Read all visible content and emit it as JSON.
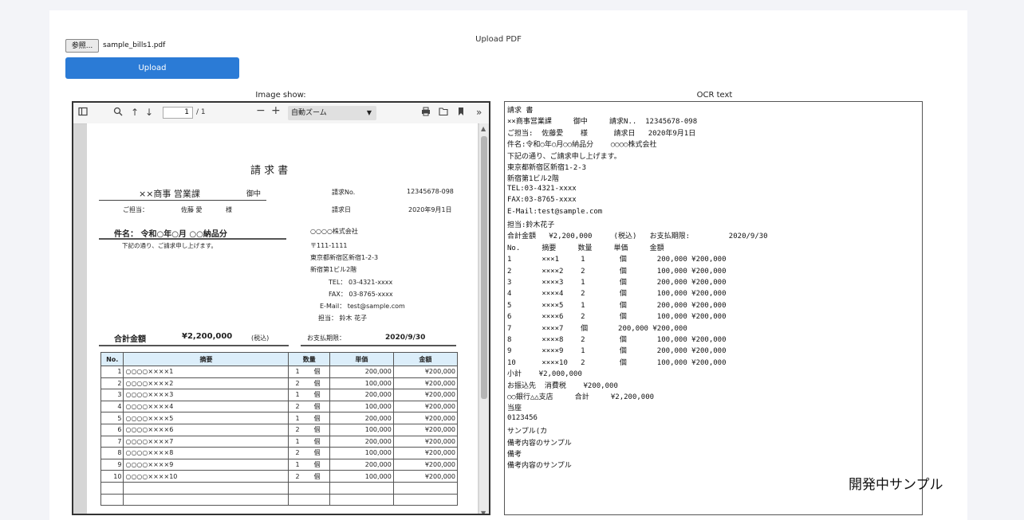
{
  "app": {
    "title": "Upload PDF",
    "browse_label": "参照...",
    "file_name": "sample_bills1.pdf",
    "upload_label": "Upload",
    "image_label": "Image show:",
    "ocr_label": "OCR text",
    "watermark": "開発中サンプル"
  },
  "viewer": {
    "page_value": "1",
    "page_total": "/ 1",
    "zoom_label": "自動ズーム"
  },
  "doc": {
    "title": "請 求 書",
    "recipient": "××商事 営業課",
    "onchu": "御中",
    "tantou_label": "ご担当：",
    "tantou_name": "佐藤 愛",
    "sama": "様",
    "inv_no_label": "請求No.",
    "inv_no": "12345678-098",
    "date_label": "請求日",
    "date": "2020年9月1日",
    "subject": "件名： 令和○年○月 ○○納品分",
    "note": "下記の通り、ご請求申し上げます。",
    "company": "○○○○株式会社",
    "zip": "〒111-1111",
    "addr1": "東京都新宿区新宿1-2-3",
    "addr2": "新宿第1ビル2階",
    "tel": "TEL： 03-4321-xxxx",
    "fax": "FAX： 03-8765-xxxx",
    "email": "E-Mail： test@sample.com",
    "staff": "担当： 鈴木 花子",
    "total_label": "合計金額",
    "total": "¥2,200,000",
    "tax_note": "(税込)",
    "due_label": "お支払期限：",
    "due": "2020/9/30",
    "headers": [
      "No.",
      "摘要",
      "数量",
      "単価",
      "金額"
    ],
    "rows": [
      [
        "1",
        "○○○○××××1",
        "1",
        "個",
        "200,000",
        "¥200,000"
      ],
      [
        "2",
        "○○○○××××2",
        "2",
        "個",
        "100,000",
        "¥200,000"
      ],
      [
        "3",
        "○○○○××××3",
        "1",
        "個",
        "200,000",
        "¥200,000"
      ],
      [
        "4",
        "○○○○××××4",
        "2",
        "個",
        "100,000",
        "¥200,000"
      ],
      [
        "5",
        "○○○○××××5",
        "1",
        "個",
        "200,000",
        "¥200,000"
      ],
      [
        "6",
        "○○○○××××6",
        "2",
        "個",
        "100,000",
        "¥200,000"
      ],
      [
        "7",
        "○○○○××××7",
        "1",
        "個",
        "200,000",
        "¥200,000"
      ],
      [
        "8",
        "○○○○××××8",
        "2",
        "個",
        "100,000",
        "¥200,000"
      ],
      [
        "9",
        "○○○○××××9",
        "1",
        "個",
        "200,000",
        "¥200,000"
      ],
      [
        "10",
        "○○○○××××10",
        "2",
        "個",
        "100,000",
        "¥200,000"
      ]
    ]
  },
  "ocr_lines": [
    "請求 書",
    "××商事営業課     御中     請求N..  12345678-098",
    "ご担当:  佐藤愛    様      請求日   2020年9月1日",
    "件名:令和○年○月○○納品分    ○○○○株式会社",
    "下記の通り、ご請求申し上げます。",
    "東京都新宿区新宿1-2-3",
    "新宿第1ビル2階",
    "TEL:03-4321-xxxx",
    "FAX:03-8765-xxxx",
    "E-Mail:test@sample.com",
    "担当:鈴木花子",
    "合計金額   ¥2,200,000     (税込)   お支払期限:         2020/9/30",
    "No.     摘要     数量     単価     金額",
    "1       ×××1     1        個       200,000 ¥200,000",
    "2       ××××2    2        個       100,000 ¥200,000",
    "3       ××××3    1        個       200,000 ¥200,000",
    "4       ××××4    2        個       100,000 ¥200,000",
    "5       ××××5    1        個       200,000 ¥200,000",
    "6       ××××6    2        個       100,000 ¥200,000",
    "7       ××××7    個       200,000 ¥200,000",
    "8       ××××8    2        個       100,000 ¥200,000",
    "9       ××××9    1        個       200,000 ¥200,000",
    "10      ××××10   2        個       100,000 ¥200,000",
    "小計    ¥2,000,000",
    "お振込先  消費税    ¥200,000",
    "○○銀行△△支店     合計     ¥2,200,000",
    "当座",
    "0123456",
    "サンプル(カ",
    "備考内容のサンプル",
    "備考",
    "備考内容のサンプル"
  ]
}
